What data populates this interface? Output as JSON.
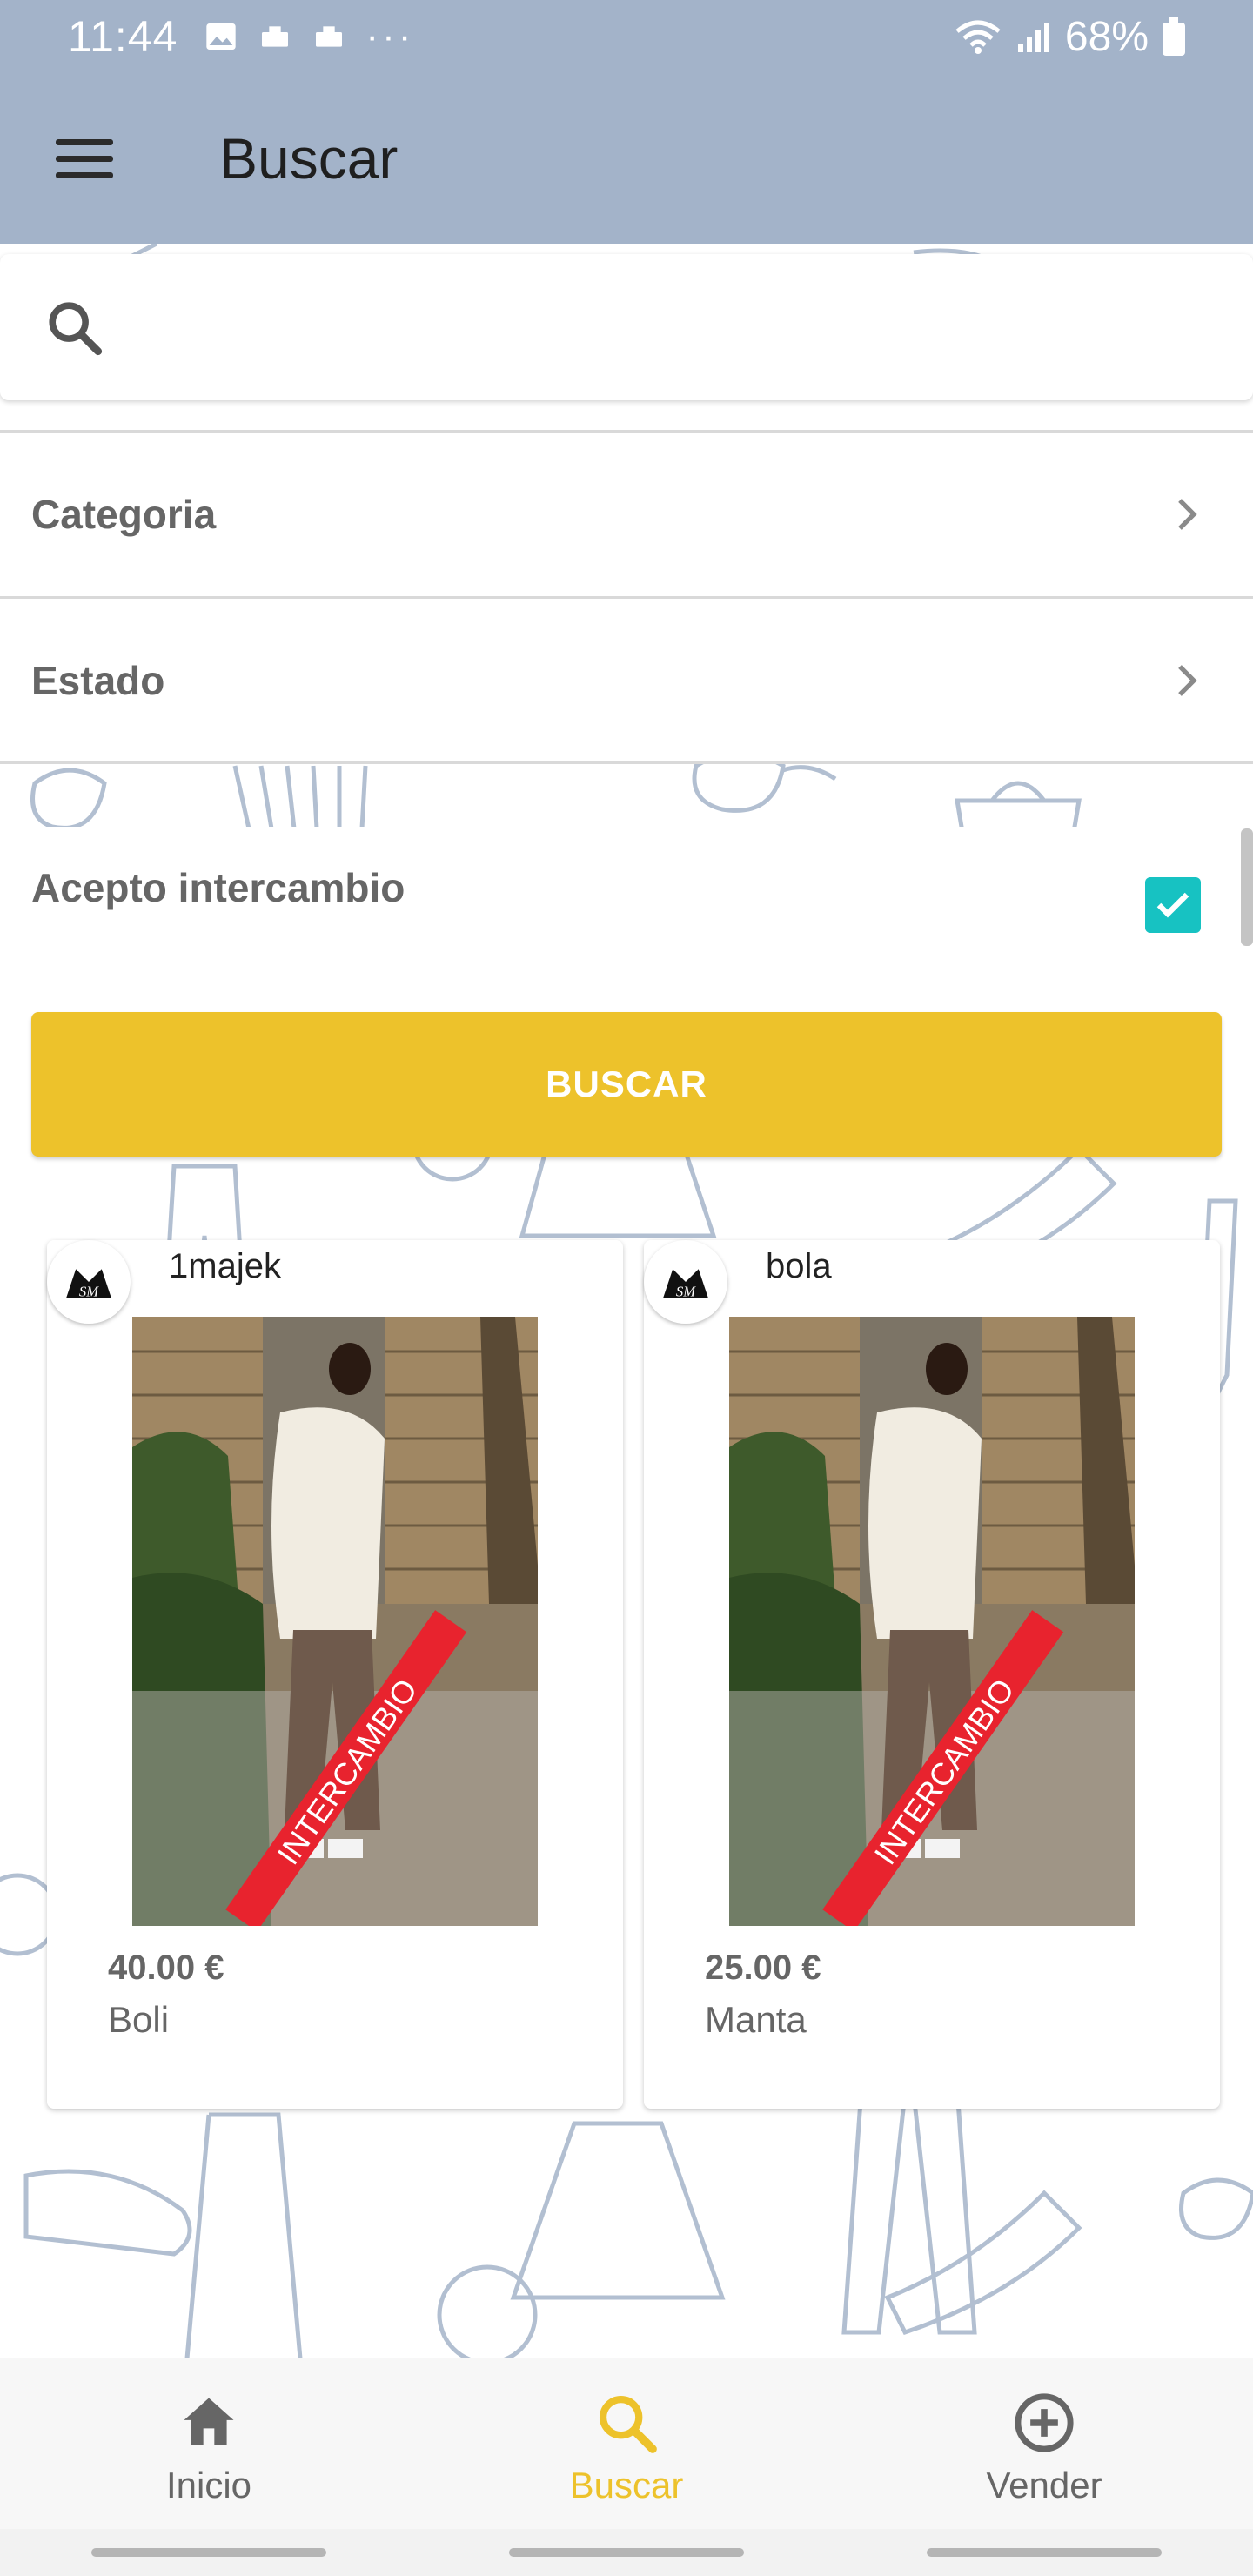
{
  "status_bar": {
    "time": "11:44",
    "battery": "68%",
    "icons": [
      "image-icon",
      "briefcase-icon",
      "briefcase-icon",
      "more-icon",
      "wifi-icon",
      "signal-icon",
      "battery-icon"
    ]
  },
  "app_bar": {
    "title": "Buscar",
    "menu_icon": "menu-icon"
  },
  "search": {
    "value": "",
    "placeholder": ""
  },
  "filters": {
    "categoria_label": "Categoria",
    "estado_label": "Estado",
    "acepto_label": "Acepto intercambio",
    "acepto_checked": true
  },
  "buscar_button": "BUSCAR",
  "products": [
    {
      "seller": "1majek",
      "price": "40.00 €",
      "name": "Boli",
      "badge": "INTERCAMBIO",
      "avatar_text": "SM"
    },
    {
      "seller": "bola",
      "price": "25.00 €",
      "name": "Manta",
      "badge": "INTERCAMBIO",
      "avatar_text": "SM"
    }
  ],
  "bottom_nav": {
    "items": [
      {
        "label": "Inicio",
        "icon": "home-icon",
        "active": false
      },
      {
        "label": "Buscar",
        "icon": "search-icon",
        "active": true
      },
      {
        "label": "Vender",
        "icon": "add-circle-icon",
        "active": false
      }
    ]
  },
  "colors": {
    "app_bar": "#a3b3c9",
    "accent": "#edc22b",
    "checkbox": "#17c2c2",
    "badge_red": "#e8232e"
  }
}
